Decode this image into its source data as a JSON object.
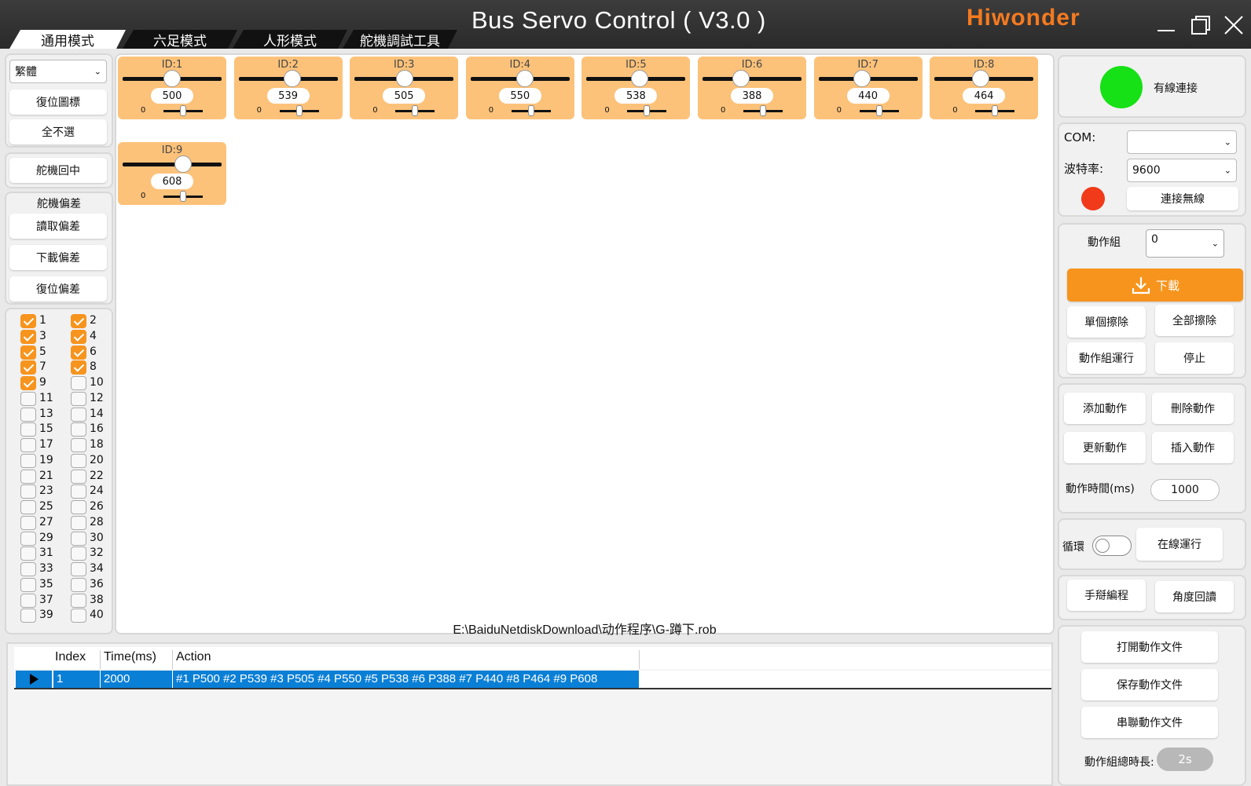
{
  "window": {
    "title": "Bus Servo Control ( V3.0 )",
    "brand": "Hiwonder",
    "brand_color": "#f47a20",
    "accent_color": "#f7941d"
  },
  "tabs": [
    {
      "label": "通用模式"
    },
    {
      "label": "六足模式"
    },
    {
      "label": "人形模式"
    },
    {
      "label": "舵機調試工具"
    }
  ],
  "left": {
    "language": "繁體",
    "reset_icon": "復位圖標",
    "deselect_all": "全不選",
    "servo_center": "舵機回中",
    "offset_title": "舵機偏差",
    "read_offset": "讀取偏差",
    "download_offset": "下載偏差",
    "reset_offset": "復位偏差"
  },
  "checks": [
    {
      "n": "1",
      "on": true
    },
    {
      "n": "2",
      "on": true
    },
    {
      "n": "3",
      "on": true
    },
    {
      "n": "4",
      "on": true
    },
    {
      "n": "5",
      "on": true
    },
    {
      "n": "6",
      "on": true
    },
    {
      "n": "7",
      "on": true
    },
    {
      "n": "8",
      "on": true
    },
    {
      "n": "9",
      "on": true
    },
    {
      "n": "10",
      "on": false
    },
    {
      "n": "11",
      "on": false
    },
    {
      "n": "12",
      "on": false
    },
    {
      "n": "13",
      "on": false
    },
    {
      "n": "14",
      "on": false
    },
    {
      "n": "15",
      "on": false
    },
    {
      "n": "16",
      "on": false
    },
    {
      "n": "17",
      "on": false
    },
    {
      "n": "18",
      "on": false
    },
    {
      "n": "19",
      "on": false
    },
    {
      "n": "20",
      "on": false
    },
    {
      "n": "21",
      "on": false
    },
    {
      "n": "22",
      "on": false
    },
    {
      "n": "23",
      "on": false
    },
    {
      "n": "24",
      "on": false
    },
    {
      "n": "25",
      "on": false
    },
    {
      "n": "26",
      "on": false
    },
    {
      "n": "27",
      "on": false
    },
    {
      "n": "28",
      "on": false
    },
    {
      "n": "29",
      "on": false
    },
    {
      "n": "30",
      "on": false
    },
    {
      "n": "31",
      "on": false
    },
    {
      "n": "32",
      "on": false
    },
    {
      "n": "33",
      "on": false
    },
    {
      "n": "34",
      "on": false
    },
    {
      "n": "35",
      "on": false
    },
    {
      "n": "36",
      "on": false
    },
    {
      "n": "37",
      "on": false
    },
    {
      "n": "38",
      "on": false
    },
    {
      "n": "39",
      "on": false
    },
    {
      "n": "40",
      "on": false
    }
  ],
  "servos": [
    {
      "id": "ID:1",
      "value": "500",
      "offset": "0",
      "pos": 0.5,
      "off": 0.5
    },
    {
      "id": "ID:2",
      "value": "539",
      "offset": "0",
      "pos": 0.539,
      "off": 0.5
    },
    {
      "id": "ID:3",
      "value": "505",
      "offset": "0",
      "pos": 0.505,
      "off": 0.5
    },
    {
      "id": "ID:4",
      "value": "550",
      "offset": "0",
      "pos": 0.55,
      "off": 0.5
    },
    {
      "id": "ID:5",
      "value": "538",
      "offset": "0",
      "pos": 0.538,
      "off": 0.5
    },
    {
      "id": "ID:6",
      "value": "388",
      "offset": "0",
      "pos": 0.388,
      "off": 0.5
    },
    {
      "id": "ID:7",
      "value": "440",
      "offset": "0",
      "pos": 0.44,
      "off": 0.5
    },
    {
      "id": "ID:8",
      "value": "464",
      "offset": "0",
      "pos": 0.464,
      "off": 0.5
    },
    {
      "id": "ID:9",
      "value": "608",
      "offset": "0",
      "pos": 0.608,
      "off": 0.5
    }
  ],
  "file_path": "E:\\BaiduNetdiskDownload\\动作程序\\G-蹲下.rob",
  "table": {
    "headers": [
      "Index",
      "Time(ms)",
      "Action"
    ],
    "rows": [
      {
        "index": "1",
        "time": "2000",
        "action": "#1 P500 #2 P539 #3 P505 #4 P550 #5 P538 #6 P388 #7 P440 #8 P464 #9 P608"
      }
    ]
  },
  "right": {
    "wired_status": "有線連接",
    "wired_color": "#16e016",
    "com_label": "COM:",
    "com_value": "",
    "baud_label": "波特率:",
    "baud_value": "9600",
    "wireless_color": "#f03a1a",
    "connect_wireless": "連接無線",
    "group_label": "動作組",
    "group_value": "0",
    "download": "下載",
    "erase_one": "單個擦除",
    "erase_all": "全部擦除",
    "run_group": "動作組運行",
    "stop": "停止",
    "add_action": "添加動作",
    "delete_action": "刪除動作",
    "update_action": "更新動作",
    "insert_action": "插入動作",
    "time_label": "動作時間(ms)",
    "time_value": "1000",
    "loop_label": "循環",
    "online_run": "在線運行",
    "handle_program": "手搿編程",
    "angle_readback": "角度回讀",
    "open_file": "打開動作文件",
    "save_file": "保存動作文件",
    "chain_file": "串聯動作文件",
    "total_label": "動作組總時長:",
    "total_value": "2s"
  }
}
